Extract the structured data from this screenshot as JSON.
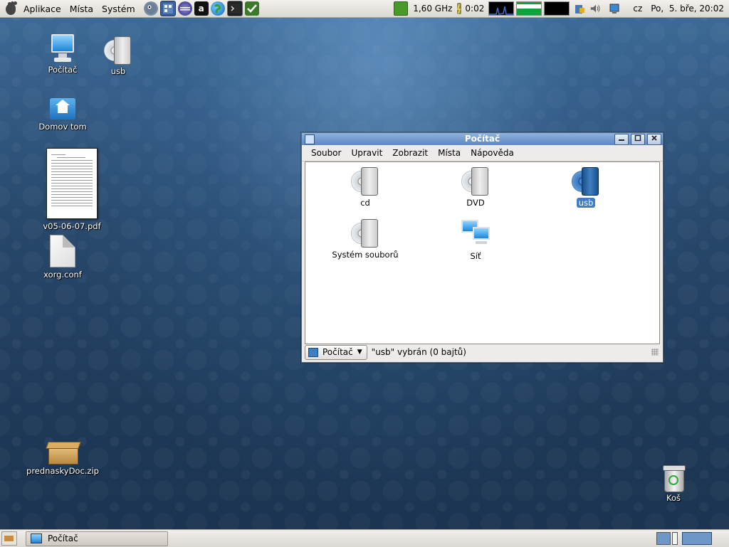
{
  "top_panel": {
    "menus": {
      "applications": "Aplikace",
      "places": "Místa",
      "system": "Systém"
    },
    "launchers": [
      "gimp-icon",
      "wallpaper-icon",
      "eclipse-icon",
      "amarok-icon",
      "web-browser-icon",
      "terminal-icon",
      "check-icon"
    ],
    "cpu_freq": "1,60 GHz",
    "battery_time": "0:02",
    "keyboard_layout": "cz",
    "clock": "Po,  5. bře, 20:02"
  },
  "desktop": {
    "computer_label": "Počítač",
    "usb_label": "usb",
    "home_label": "Domov tom",
    "pdf_label": "v05-06-07.pdf",
    "xorg_label": "xorg.conf",
    "zip_label": "prednaskyDoc.zip",
    "trash_label": "Koš"
  },
  "window": {
    "title": "Počítač",
    "menu": {
      "file": "Soubor",
      "edit": "Upravit",
      "view": "Zobrazit",
      "places": "Místa",
      "help": "Nápověda"
    },
    "items": {
      "cd": "cd",
      "dvd": "DVD",
      "usb": "usb",
      "filesystem": "Systém souborů",
      "network": "Síť"
    },
    "location": "Počítač",
    "status": "\"usb\" vybrán (0 bajtů)"
  },
  "bottom_panel": {
    "task_label": "Počítač"
  },
  "colors": {
    "selection": "#3d7fc2",
    "titlebar": "#6b93c9",
    "desktop": "#28486c"
  }
}
